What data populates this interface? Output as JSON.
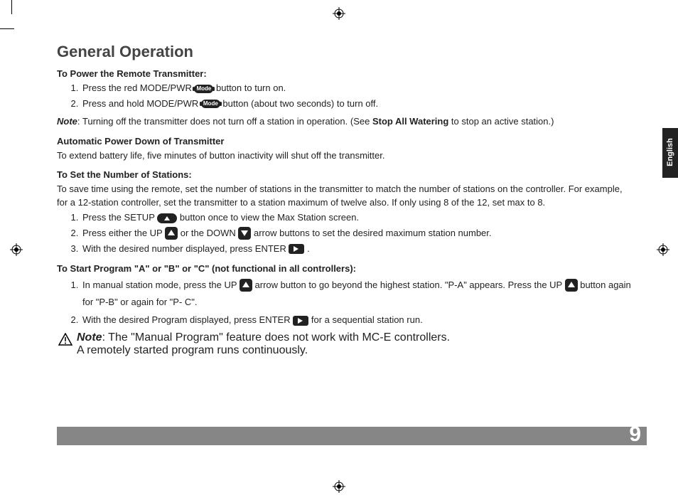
{
  "language_tab": "English",
  "page_number": "9",
  "title": "General Operation",
  "sections": {
    "power": {
      "heading": "To Power the Remote Transmitter:",
      "item1_a": "Press the red MODE/PWR ",
      "item1_b": "  button to turn on.",
      "item2_a": "Press and hold MODE/PWR ",
      "item2_b": " button (about two seconds) to turn off.",
      "note_label": "Note",
      "note_a": ":  Turning off the transmitter does not turn off a station in operation. (See ",
      "note_bold": "Stop All Watering",
      "note_b": " to stop an active station.)"
    },
    "autopower": {
      "heading": "Automatic Power Down of Transmitter",
      "text": "To extend battery life, five minutes of button inactivity will shut off the transmitter."
    },
    "stations": {
      "heading": "To Set the Number of Stations:",
      "intro": "To save time using the remote, set the number of stations in the transmitter to match the number of stations on the controller. For example, for a 12-station controller, set the transmitter to a station maximum of twelve also. If only using 8 of the 12, set max to 8.",
      "item1_a": "Press the SETUP ",
      "item1_b": " button once to view the Max Station screen.",
      "item2_a": "Press either the UP ",
      "item2_b": " or the DOWN ",
      "item2_c": " arrow buttons to set the desired maximum station number.",
      "item3_a": "With the desired number displayed, press ENTER ",
      "item3_b": "."
    },
    "program": {
      "heading": "To Start Program \"A\" or \"B\" or \"C\" (not functional in all controllers):",
      "item1_a": "In manual station mode, press the UP ",
      "item1_b": " arrow button to go beyond the highest station. \"P-A\" appears. Press the UP ",
      "item1_c": " button again for \"P-B\" or again for \"P- C\".",
      "item2_a": "With the desired Program displayed, press ENTER ",
      "item2_b": " for a sequential station run.",
      "warn_label": "Note",
      "warn_a": ": The \"Manual Program\" feature does not work with MC-E controllers.",
      "warn_b": "A remotely started program runs continuously."
    }
  },
  "icons": {
    "mode_label": "Mode"
  }
}
